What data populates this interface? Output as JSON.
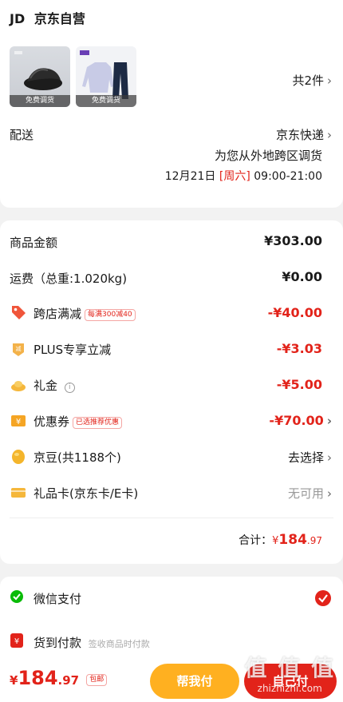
{
  "shop": {
    "logo": "JD",
    "name": "京东自营"
  },
  "products": [
    {
      "tag": "免费调货"
    },
    {
      "tag": "免费调货"
    }
  ],
  "products_count": "共2件",
  "delivery": {
    "label": "配送",
    "method": "京东快递",
    "note": "为您从外地跨区调货",
    "date": "12月21日",
    "weekday": "[周六]",
    "time": "09:00-21:00"
  },
  "summary": {
    "goods_label": "商品金额",
    "goods_value": "¥303.00",
    "freight_label": "运费（总重:1.020kg)",
    "freight_value": "¥0.00",
    "cross_label": "跨店满减",
    "cross_badge": "每满300减40",
    "cross_value": "-¥40.00",
    "plus_label": "PLUS专享立减",
    "plus_value": "-¥3.03",
    "gift_label": "礼金",
    "gift_value": "-¥5.00",
    "coupon_label": "优惠券",
    "coupon_badge": "已选推荐优惠",
    "coupon_value": "-¥70.00",
    "bean_label": "京豆(共1188个)",
    "bean_value": "去选择",
    "card_label": "礼品卡(京东卡/E卡)",
    "card_value": "无可用",
    "total_label": "合计：",
    "total_symbol": "¥",
    "total_int": "184",
    "total_dec": ".97"
  },
  "payment": {
    "wechat_label": "微信支付",
    "cod_label": "货到付款",
    "cod_note": "签收商品时付款"
  },
  "bottom": {
    "symbol": "¥",
    "int": "184",
    "dec": ".97",
    "badge": "包邮",
    "help_label": "帮我付",
    "self_label": "自己付"
  },
  "watermark": {
    "text": "值 值 值",
    "url": "zhizhizhi.com"
  },
  "colors": {
    "accent_red": "#e2231a",
    "wechat_green": "#09bb07",
    "help_yellow": "#ffb020"
  }
}
